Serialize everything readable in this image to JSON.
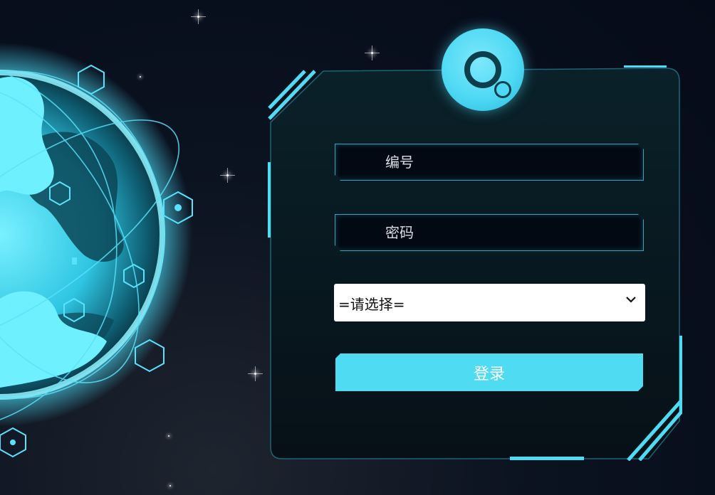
{
  "form": {
    "id_placeholder": "编号",
    "password_placeholder": "密码",
    "role_select_value": "=请选择=",
    "submit_label": "登录"
  },
  "colors": {
    "accent": "#4fdcf3",
    "background": "#050b18",
    "panel": "#06141d"
  }
}
